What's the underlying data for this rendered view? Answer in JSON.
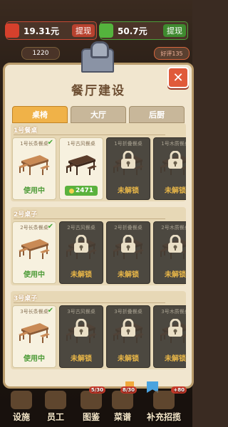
{
  "top": {
    "cash_value": "19.31元",
    "cash_withdraw": "提现",
    "wechat_value": "50.7元",
    "wechat_withdraw": "提现",
    "coins": "1220",
    "rating": "好评135"
  },
  "panel": {
    "title": "餐厅建设",
    "close": "✕",
    "tabs": [
      "桌椅",
      "大厅",
      "后厨"
    ]
  },
  "sections": [
    {
      "title": "1号餐桌",
      "cards": [
        {
          "name": "1号长条餐桌",
          "state": "owned",
          "status": "使用中"
        },
        {
          "name": "1号古风餐桌",
          "state": "shop",
          "price": "2471"
        },
        {
          "name": "1号折叠餐桌",
          "state": "locked",
          "status": "未解锁"
        },
        {
          "name": "1号木质餐桌",
          "state": "locked",
          "status": "未解锁"
        }
      ]
    },
    {
      "title": "2号桌子",
      "cards": [
        {
          "name": "2号长条餐桌",
          "state": "owned",
          "status": "使用中"
        },
        {
          "name": "2号古风餐桌",
          "state": "locked",
          "status": "未解锁"
        },
        {
          "name": "2号折叠餐桌",
          "state": "locked",
          "status": "未解锁"
        },
        {
          "name": "2号木质餐桌",
          "state": "locked",
          "status": "未解锁"
        }
      ]
    },
    {
      "title": "3号桌子",
      "cards": [
        {
          "name": "3号长条餐桌",
          "state": "owned",
          "status": "使用中"
        },
        {
          "name": "3号古风餐桌",
          "state": "locked",
          "status": "未解锁"
        },
        {
          "name": "3号折叠餐桌",
          "state": "locked",
          "status": "未解锁"
        },
        {
          "name": "3号木质餐桌",
          "state": "locked",
          "status": "未解锁"
        }
      ]
    }
  ],
  "nav": [
    {
      "label": "设施",
      "icon": "facility-icon"
    },
    {
      "label": "员工",
      "icon": "staff-icon"
    },
    {
      "label": "图鉴",
      "icon": "catalog-icon",
      "badge": "5/30"
    },
    {
      "label": "菜谱",
      "icon": "recipe-icon",
      "badge": "8/30"
    },
    {
      "label": "补充招揽",
      "icon": "megaphone-icon",
      "badge": "+80"
    }
  ],
  "colors": {
    "accent": "#f0b248",
    "locked_text": "#e8b648",
    "inuse_text": "#4b9a35",
    "close": "#e05a3a"
  }
}
